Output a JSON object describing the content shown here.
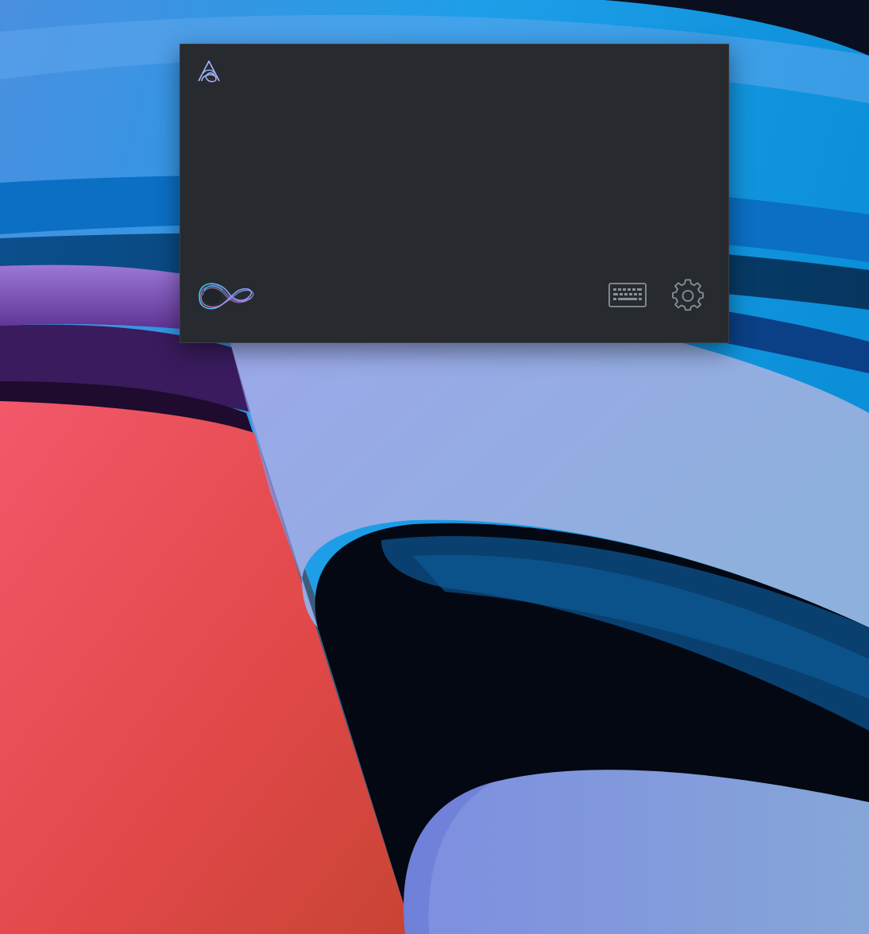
{
  "desktop": {
    "wallpaper": "abstract-curved-bands-wallpaper",
    "colors": {
      "deep_blue": "#0b2a5e",
      "sky_blue": "#1aa0e6",
      "periwinkle": "#8ea4e0",
      "purple": "#6a3fa6",
      "coral": "#e8504e",
      "dark": "#03060f"
    }
  },
  "assistant": {
    "background": "#272a2f",
    "transcript_text": "",
    "icons": {
      "logo": "app-logo-icon",
      "orb": "voice-orb-icon",
      "keyboard": "keyboard-icon",
      "settings": "gear-icon"
    },
    "accent_colors": [
      "#3fc8f2",
      "#b78cf0",
      "#f08cc8"
    ]
  }
}
